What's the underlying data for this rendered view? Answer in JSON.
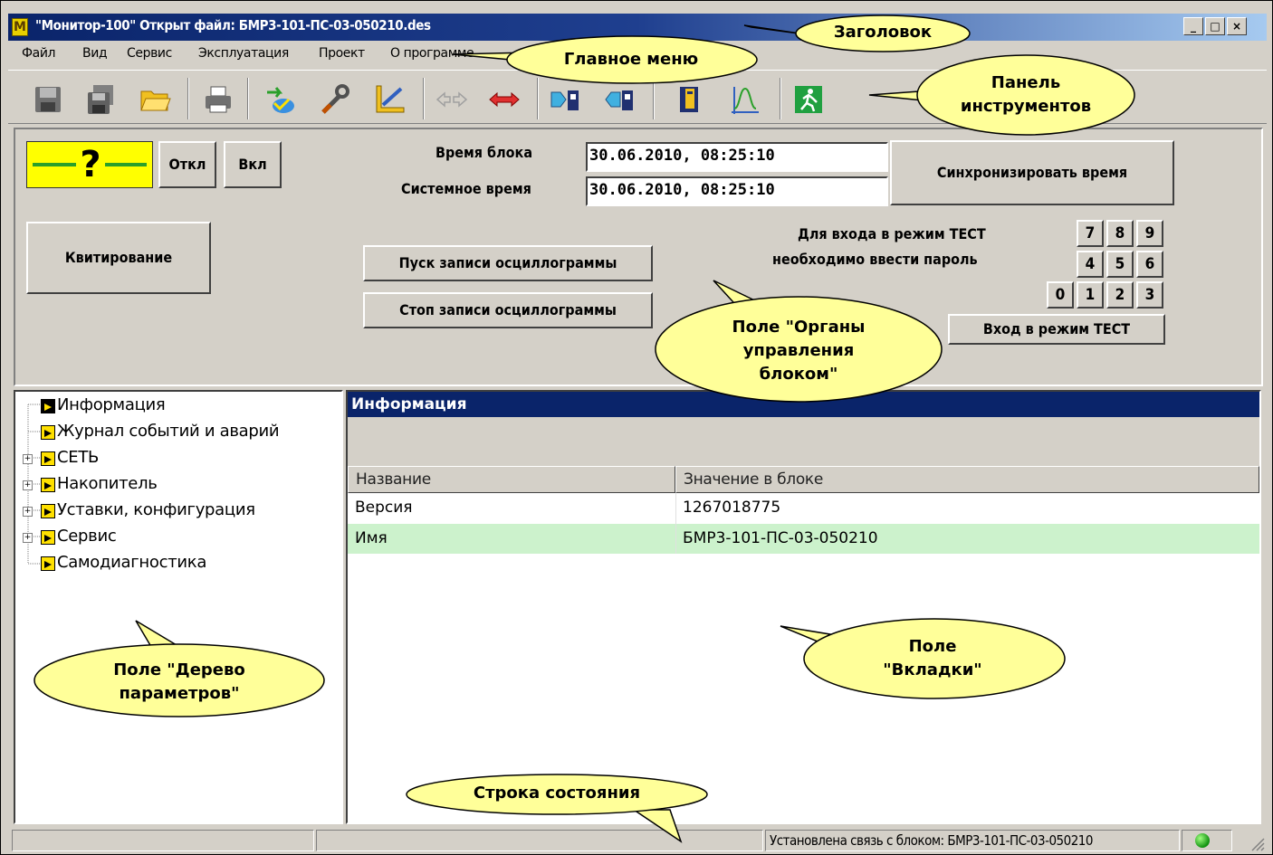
{
  "window": {
    "icon_letter": "M",
    "title": "\"Монитор-100\"   Открыт файл: БМР3-101-ПС-03-050210.des",
    "controls": [
      "_",
      "□",
      "×"
    ]
  },
  "menu": [
    "Файл",
    "Вид",
    "Сервис",
    "Эксплуатация",
    "Проект",
    "О программе"
  ],
  "toolbar": {
    "icons": [
      "save-icon",
      "save-all-icon",
      "open-folder-icon",
      "print-icon",
      "transfer-icon",
      "wrench-icon",
      "measure-icon",
      "arrows-disabled-icon",
      "arrows-red-icon",
      "upload-block-icon",
      "download-block-icon",
      "book-icon",
      "oscillogram-icon",
      "exit-icon"
    ]
  },
  "control": {
    "indicator": "?",
    "off_button": "Откл",
    "on_button": "Вкл",
    "block_time_label": "Время блока",
    "block_time_value": "30.06.2010, 08:25:10",
    "system_time_label": "Системное время",
    "system_time_value": "30.06.2010, 08:25:10",
    "sync_button": "Синхронизировать время",
    "ack_button": "Квитирование",
    "start_osc_button": "Пуск записи осциллограммы",
    "stop_osc_button": "Стоп записи осциллограммы",
    "test_hint_line1": "Для входа в режим ТЕСТ",
    "test_hint_line2": "необходимо ввести пароль",
    "keypad": [
      "7",
      "8",
      "9",
      "4",
      "5",
      "6",
      "0",
      "1",
      "2",
      "3"
    ],
    "test_button": "Вход в режим ТЕСТ"
  },
  "tree": {
    "items": [
      {
        "label": "Информация",
        "expandable": false
      },
      {
        "label": "Журнал событий и аварий",
        "expandable": false
      },
      {
        "label": "СЕТЬ",
        "expandable": true
      },
      {
        "label": "Накопитель",
        "expandable": true
      },
      {
        "label": "Уставки, конфигурация",
        "expandable": true
      },
      {
        "label": "Сервис",
        "expandable": true
      },
      {
        "label": "Самодиагностика",
        "expandable": false
      }
    ]
  },
  "tab": {
    "title": "Информация",
    "columns": [
      "Название",
      "Значение в блоке"
    ],
    "rows": [
      {
        "name": "Версия",
        "value": "1267018775"
      },
      {
        "name": "Имя",
        "value": "БМР3-101-ПС-03-050210"
      }
    ]
  },
  "statusbar": {
    "panel1": "",
    "panel2": "",
    "connection": "Установлена связь с блоком: БМР3-101-ПС-03-050210"
  },
  "callouts": {
    "title": "Заголовок",
    "menu": "Главное меню",
    "toolbar_line1": "Панель",
    "toolbar_line2": "инструментов",
    "controls_line1": "Поле \"Органы",
    "controls_line2": "управления",
    "controls_line3": "блоком\"",
    "tree_line1": "Поле \"Дерево",
    "tree_line2": "параметров\"",
    "tabs_line1": "Поле",
    "tabs_line2": "\"Вкладки\"",
    "status": "Строка состояния"
  },
  "colors": {
    "titlebar": "#0a246a",
    "window_face": "#d4d0c8",
    "indicator": "#ffff00",
    "indicator_line": "#2aa02a",
    "callout_fill": "#ffff99",
    "selected_row": "#ccf2cc",
    "tree_arrow": "#ffe000"
  }
}
